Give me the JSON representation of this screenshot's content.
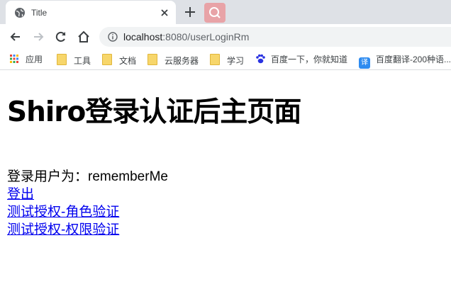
{
  "browser": {
    "tab": {
      "title": "Title",
      "favicon": "globe-icon"
    },
    "address_bar": {
      "host": "localhost",
      "path": ":8080/userLoginRm"
    },
    "bookmarks": [
      {
        "label": "应用",
        "icon": "apps-grid-icon"
      },
      {
        "label": "工具",
        "icon": "folder-icon"
      },
      {
        "label": "文档",
        "icon": "folder-icon"
      },
      {
        "label": "云服务器",
        "icon": "folder-icon"
      },
      {
        "label": "学习",
        "icon": "folder-icon"
      },
      {
        "label": "百度一下，你就知道",
        "icon": "baidu-paw-icon"
      },
      {
        "label": "百度翻译-200种语...",
        "icon": "translate-icon"
      }
    ]
  },
  "page": {
    "heading": "Shiro登录认证后主页面",
    "user_line": "登录用户为：rememberMe",
    "links": {
      "logout": "登出",
      "role_test": "测试授权-角色验证",
      "permission_test": "测试授权-权限验证"
    }
  },
  "colors": {
    "tabstrip": "#dee1e6",
    "omnibox": "#f1f3f4",
    "link": "#0000ee",
    "extension_button": "#e8a3a7"
  }
}
